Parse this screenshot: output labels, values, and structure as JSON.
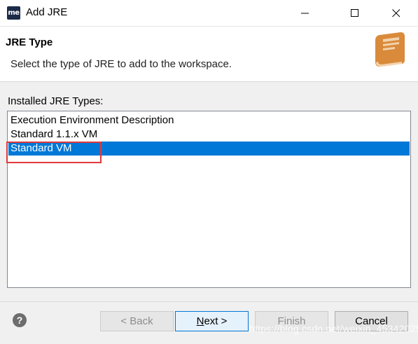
{
  "window": {
    "app_icon_text": "me",
    "title": "Add JRE"
  },
  "header": {
    "title": "JRE Type",
    "description": "Select the type of JRE to add to the workspace.",
    "icon": "book-icon"
  },
  "list": {
    "label": "Installed JRE Types:",
    "items": [
      "Execution Environment Description",
      "Standard 1.1.x VM",
      "Standard VM"
    ],
    "selected": "Standard VM"
  },
  "buttons": {
    "back": "< Back",
    "next_mnemonic": "N",
    "next_rest": "ext >",
    "finish": "Finish",
    "cancel": "Cancel",
    "help_glyph": "?"
  },
  "watermark": "https://blog.csdn.net/weixin_45342025",
  "colors": {
    "selection": "#0078d7",
    "highlight_box": "#e0393a",
    "app_icon_bg": "#1b2a47",
    "header_icon": "#d98a3a"
  }
}
